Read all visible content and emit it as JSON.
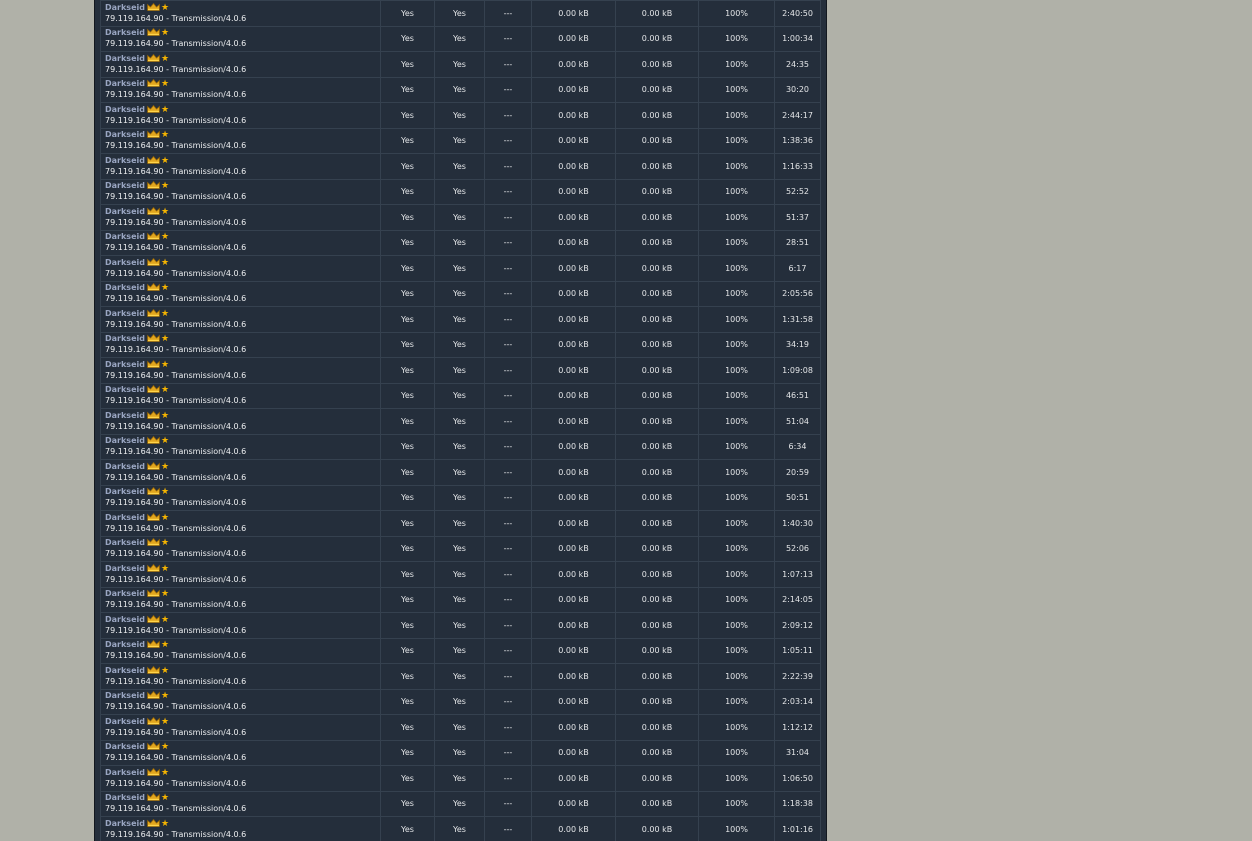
{
  "peer": {
    "username": "Darkseid",
    "client": "79.119.164.90 - Transmission/4.0.6",
    "badge_icons": [
      "crown-icon",
      "star-icon"
    ]
  },
  "colors": {
    "yes": "#2fb12f",
    "panel": "#242e3b",
    "username": "#9aa6c2",
    "star": "#f5b400"
  },
  "rows": [
    {
      "connectable": "Yes",
      "seeding": "Yes",
      "speed": "---",
      "uploaded": "0.00 kB",
      "downloaded": "0.00 kB",
      "ratio": "100%",
      "time": "2:40:50"
    },
    {
      "connectable": "Yes",
      "seeding": "Yes",
      "speed": "---",
      "uploaded": "0.00 kB",
      "downloaded": "0.00 kB",
      "ratio": "100%",
      "time": "1:00:34"
    },
    {
      "connectable": "Yes",
      "seeding": "Yes",
      "speed": "---",
      "uploaded": "0.00 kB",
      "downloaded": "0.00 kB",
      "ratio": "100%",
      "time": "24:35"
    },
    {
      "connectable": "Yes",
      "seeding": "Yes",
      "speed": "---",
      "uploaded": "0.00 kB",
      "downloaded": "0.00 kB",
      "ratio": "100%",
      "time": "30:20"
    },
    {
      "connectable": "Yes",
      "seeding": "Yes",
      "speed": "---",
      "uploaded": "0.00 kB",
      "downloaded": "0.00 kB",
      "ratio": "100%",
      "time": "2:44:17"
    },
    {
      "connectable": "Yes",
      "seeding": "Yes",
      "speed": "---",
      "uploaded": "0.00 kB",
      "downloaded": "0.00 kB",
      "ratio": "100%",
      "time": "1:38:36"
    },
    {
      "connectable": "Yes",
      "seeding": "Yes",
      "speed": "---",
      "uploaded": "0.00 kB",
      "downloaded": "0.00 kB",
      "ratio": "100%",
      "time": "1:16:33"
    },
    {
      "connectable": "Yes",
      "seeding": "Yes",
      "speed": "---",
      "uploaded": "0.00 kB",
      "downloaded": "0.00 kB",
      "ratio": "100%",
      "time": "52:52"
    },
    {
      "connectable": "Yes",
      "seeding": "Yes",
      "speed": "---",
      "uploaded": "0.00 kB",
      "downloaded": "0.00 kB",
      "ratio": "100%",
      "time": "51:37"
    },
    {
      "connectable": "Yes",
      "seeding": "Yes",
      "speed": "---",
      "uploaded": "0.00 kB",
      "downloaded": "0.00 kB",
      "ratio": "100%",
      "time": "28:51"
    },
    {
      "connectable": "Yes",
      "seeding": "Yes",
      "speed": "---",
      "uploaded": "0.00 kB",
      "downloaded": "0.00 kB",
      "ratio": "100%",
      "time": "6:17"
    },
    {
      "connectable": "Yes",
      "seeding": "Yes",
      "speed": "---",
      "uploaded": "0.00 kB",
      "downloaded": "0.00 kB",
      "ratio": "100%",
      "time": "2:05:56"
    },
    {
      "connectable": "Yes",
      "seeding": "Yes",
      "speed": "---",
      "uploaded": "0.00 kB",
      "downloaded": "0.00 kB",
      "ratio": "100%",
      "time": "1:31:58"
    },
    {
      "connectable": "Yes",
      "seeding": "Yes",
      "speed": "---",
      "uploaded": "0.00 kB",
      "downloaded": "0.00 kB",
      "ratio": "100%",
      "time": "34:19"
    },
    {
      "connectable": "Yes",
      "seeding": "Yes",
      "speed": "---",
      "uploaded": "0.00 kB",
      "downloaded": "0.00 kB",
      "ratio": "100%",
      "time": "1:09:08"
    },
    {
      "connectable": "Yes",
      "seeding": "Yes",
      "speed": "---",
      "uploaded": "0.00 kB",
      "downloaded": "0.00 kB",
      "ratio": "100%",
      "time": "46:51"
    },
    {
      "connectable": "Yes",
      "seeding": "Yes",
      "speed": "---",
      "uploaded": "0.00 kB",
      "downloaded": "0.00 kB",
      "ratio": "100%",
      "time": "51:04"
    },
    {
      "connectable": "Yes",
      "seeding": "Yes",
      "speed": "---",
      "uploaded": "0.00 kB",
      "downloaded": "0.00 kB",
      "ratio": "100%",
      "time": "6:34"
    },
    {
      "connectable": "Yes",
      "seeding": "Yes",
      "speed": "---",
      "uploaded": "0.00 kB",
      "downloaded": "0.00 kB",
      "ratio": "100%",
      "time": "20:59"
    },
    {
      "connectable": "Yes",
      "seeding": "Yes",
      "speed": "---",
      "uploaded": "0.00 kB",
      "downloaded": "0.00 kB",
      "ratio": "100%",
      "time": "50:51"
    },
    {
      "connectable": "Yes",
      "seeding": "Yes",
      "speed": "---",
      "uploaded": "0.00 kB",
      "downloaded": "0.00 kB",
      "ratio": "100%",
      "time": "1:40:30"
    },
    {
      "connectable": "Yes",
      "seeding": "Yes",
      "speed": "---",
      "uploaded": "0.00 kB",
      "downloaded": "0.00 kB",
      "ratio": "100%",
      "time": "52:06"
    },
    {
      "connectable": "Yes",
      "seeding": "Yes",
      "speed": "---",
      "uploaded": "0.00 kB",
      "downloaded": "0.00 kB",
      "ratio": "100%",
      "time": "1:07:13"
    },
    {
      "connectable": "Yes",
      "seeding": "Yes",
      "speed": "---",
      "uploaded": "0.00 kB",
      "downloaded": "0.00 kB",
      "ratio": "100%",
      "time": "2:14:05"
    },
    {
      "connectable": "Yes",
      "seeding": "Yes",
      "speed": "---",
      "uploaded": "0.00 kB",
      "downloaded": "0.00 kB",
      "ratio": "100%",
      "time": "2:09:12"
    },
    {
      "connectable": "Yes",
      "seeding": "Yes",
      "speed": "---",
      "uploaded": "0.00 kB",
      "downloaded": "0.00 kB",
      "ratio": "100%",
      "time": "1:05:11"
    },
    {
      "connectable": "Yes",
      "seeding": "Yes",
      "speed": "---",
      "uploaded": "0.00 kB",
      "downloaded": "0.00 kB",
      "ratio": "100%",
      "time": "2:22:39"
    },
    {
      "connectable": "Yes",
      "seeding": "Yes",
      "speed": "---",
      "uploaded": "0.00 kB",
      "downloaded": "0.00 kB",
      "ratio": "100%",
      "time": "2:03:14"
    },
    {
      "connectable": "Yes",
      "seeding": "Yes",
      "speed": "---",
      "uploaded": "0.00 kB",
      "downloaded": "0.00 kB",
      "ratio": "100%",
      "time": "1:12:12"
    },
    {
      "connectable": "Yes",
      "seeding": "Yes",
      "speed": "---",
      "uploaded": "0.00 kB",
      "downloaded": "0.00 kB",
      "ratio": "100%",
      "time": "31:04"
    },
    {
      "connectable": "Yes",
      "seeding": "Yes",
      "speed": "---",
      "uploaded": "0.00 kB",
      "downloaded": "0.00 kB",
      "ratio": "100%",
      "time": "1:06:50"
    },
    {
      "connectable": "Yes",
      "seeding": "Yes",
      "speed": "---",
      "uploaded": "0.00 kB",
      "downloaded": "0.00 kB",
      "ratio": "100%",
      "time": "1:18:38"
    },
    {
      "connectable": "Yes",
      "seeding": "Yes",
      "speed": "---",
      "uploaded": "0.00 kB",
      "downloaded": "0.00 kB",
      "ratio": "100%",
      "time": "1:01:16"
    }
  ]
}
